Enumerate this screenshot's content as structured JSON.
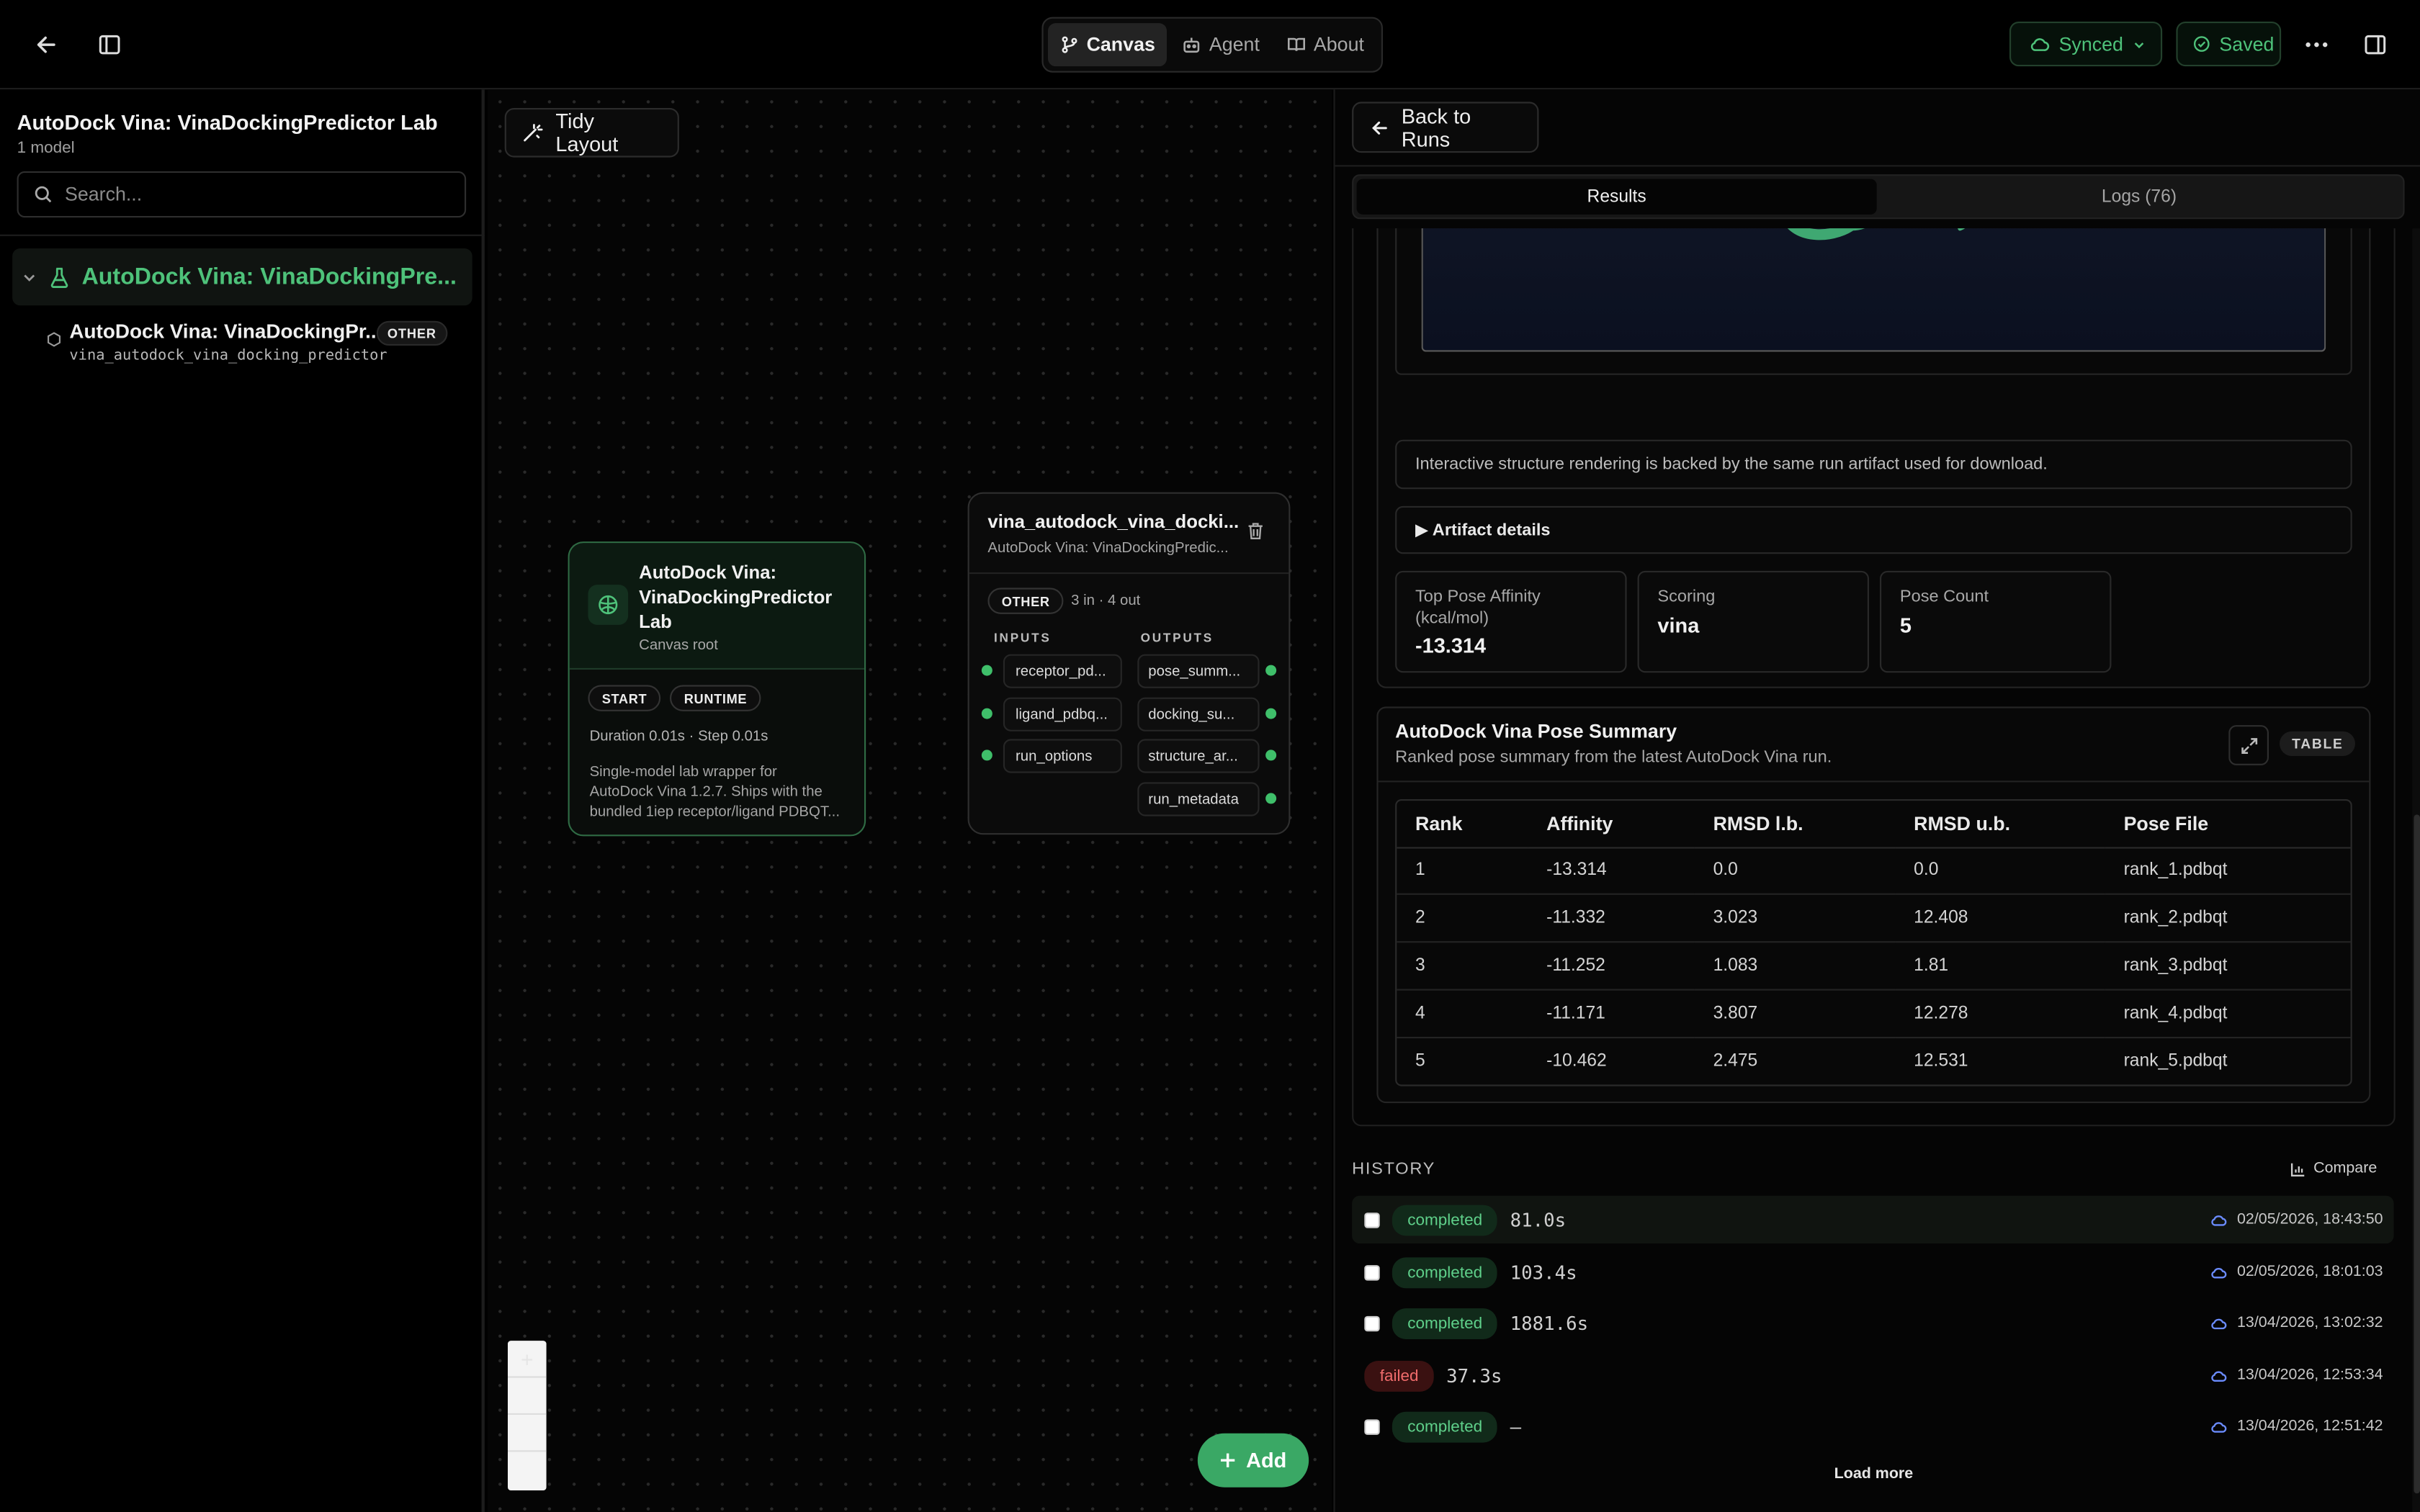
{
  "topbar": {
    "tabs": [
      {
        "label": "Canvas",
        "icon": "git-branch-icon",
        "active": true
      },
      {
        "label": "Agent",
        "icon": "robot-icon",
        "active": false
      },
      {
        "label": "About",
        "icon": "book-icon",
        "active": false
      }
    ],
    "sync_label": "Synced",
    "saved_label": "Saved"
  },
  "sidebar": {
    "title": "AutoDock Vina: VinaDockingPredictor Lab",
    "subtitle": "1 model",
    "search_placeholder": "Search...",
    "group_label": "AutoDock Vina: VinaDockingPre...",
    "model": {
      "name": "AutoDock Vina: VinaDockingPr...",
      "badge": "OTHER",
      "id": "vina_autodock_vina_docking_predictor"
    }
  },
  "canvas": {
    "tidy_label": "Tidy Layout",
    "add_label": "Add",
    "root_node": {
      "title_line1": "AutoDock Vina:",
      "title_line2": "VinaDockingPredictor",
      "title_line3": "Lab",
      "subtitle": "Canvas root",
      "chips": [
        "START",
        "RUNTIME"
      ],
      "duration": "Duration 0.01s · Step 0.01s",
      "desc_line1": "Single-model lab wrapper for",
      "desc_line2": "AutoDock Vina 1.2.7. Ships with the",
      "desc_line3": "bundled 1iep receptor/ligand PDBQT..."
    },
    "tool_node": {
      "title": "vina_autodock_vina_docki...",
      "subtitle": "AutoDock Vina: VinaDockingPredic...",
      "badge": "OTHER",
      "io_summary": "3 in · 4 out",
      "inputs_label": "INPUTS",
      "outputs_label": "OUTPUTS",
      "inputs": [
        "receptor_pd...",
        "ligand_pdbq...",
        "run_options"
      ],
      "outputs": [
        "pose_summ...",
        "docking_su...",
        "structure_ar...",
        "run_metadata"
      ]
    }
  },
  "panel": {
    "back_label": "Back to Runs",
    "tabs": {
      "results": "Results",
      "logs": "Logs (76)"
    },
    "info_text": "Interactive structure rendering is backed by the same run artifact used for download.",
    "artifact_details": "▶ Artifact details",
    "stats": [
      {
        "label_line1": "Top Pose Affinity",
        "label_line2": "(kcal/mol)",
        "value": "-13.314"
      },
      {
        "label_line1": "Scoring",
        "label_line2": "",
        "value": "vina"
      },
      {
        "label_line1": "Pose Count",
        "label_line2": "",
        "value": "5"
      }
    ],
    "summary": {
      "title": "AutoDock Vina Pose Summary",
      "subtitle": "Ranked pose summary from the latest AutoDock Vina run.",
      "badge": "TABLE",
      "columns": [
        "Rank",
        "Affinity",
        "RMSD l.b.",
        "RMSD u.b.",
        "Pose File"
      ],
      "rows": [
        [
          "1",
          "-13.314",
          "0.0",
          "0.0",
          "rank_1.pdbqt"
        ],
        [
          "2",
          "-11.332",
          "3.023",
          "12.408",
          "rank_2.pdbqt"
        ],
        [
          "3",
          "-11.252",
          "1.083",
          "1.81",
          "rank_3.pdbqt"
        ],
        [
          "4",
          "-11.171",
          "3.807",
          "12.278",
          "rank_4.pdbqt"
        ],
        [
          "5",
          "-10.462",
          "2.475",
          "12.531",
          "rank_5.pdbqt"
        ]
      ]
    },
    "history": {
      "label": "HISTORY",
      "compare_label": "Compare",
      "load_more": "Load more",
      "runs": [
        {
          "status": "completed",
          "duration": "81.0s",
          "timestamp": "02/05/2026, 18:43:50"
        },
        {
          "status": "completed",
          "duration": "103.4s",
          "timestamp": "02/05/2026, 18:01:03"
        },
        {
          "status": "completed",
          "duration": "1881.6s",
          "timestamp": "13/04/2026, 13:02:32"
        },
        {
          "status": "failed",
          "duration": "37.3s",
          "timestamp": "13/04/2026, 12:53:34"
        },
        {
          "status": "completed",
          "duration": "–",
          "timestamp": "13/04/2026, 12:51:42"
        }
      ]
    }
  },
  "colors": {
    "accent": "#3fbf6a",
    "failed": "#ef6b6b",
    "background": "#000000"
  }
}
